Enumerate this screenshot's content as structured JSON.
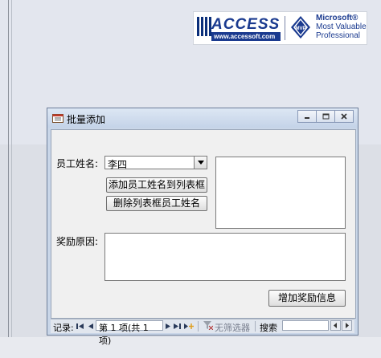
{
  "banner": {
    "access_word": "ACCESS",
    "access_url": "www.accessoft.com",
    "mvp_badge": "MVP",
    "mvp_line1": "Microsoft®",
    "mvp_line2": "Most Valuable",
    "mvp_line3": "Professional"
  },
  "dialog": {
    "title": "批量添加",
    "icons": [
      "form-icon",
      "minimize-icon",
      "restore-icon",
      "close-icon"
    ]
  },
  "form": {
    "name_label": "员工姓名:",
    "name_value": "李四",
    "add_button": "添加员工姓名到列表框",
    "delete_button": "删除列表框员工姓名",
    "reason_label": "奖励原因:",
    "reason_value": "",
    "info_button": "增加奖励信息"
  },
  "navbar": {
    "record_label": "记录:",
    "record_position": "第 1 项(共 1 项)",
    "filter_label": "无筛选器",
    "search_label": "搜索",
    "icons": [
      "first-record-icon",
      "prev-record-icon",
      "next-record-icon",
      "last-record-icon",
      "new-record-icon",
      "filter-icon"
    ]
  },
  "colors": {
    "accent": "#1a3a8f",
    "dialog_frame": "#c9d6e8"
  }
}
